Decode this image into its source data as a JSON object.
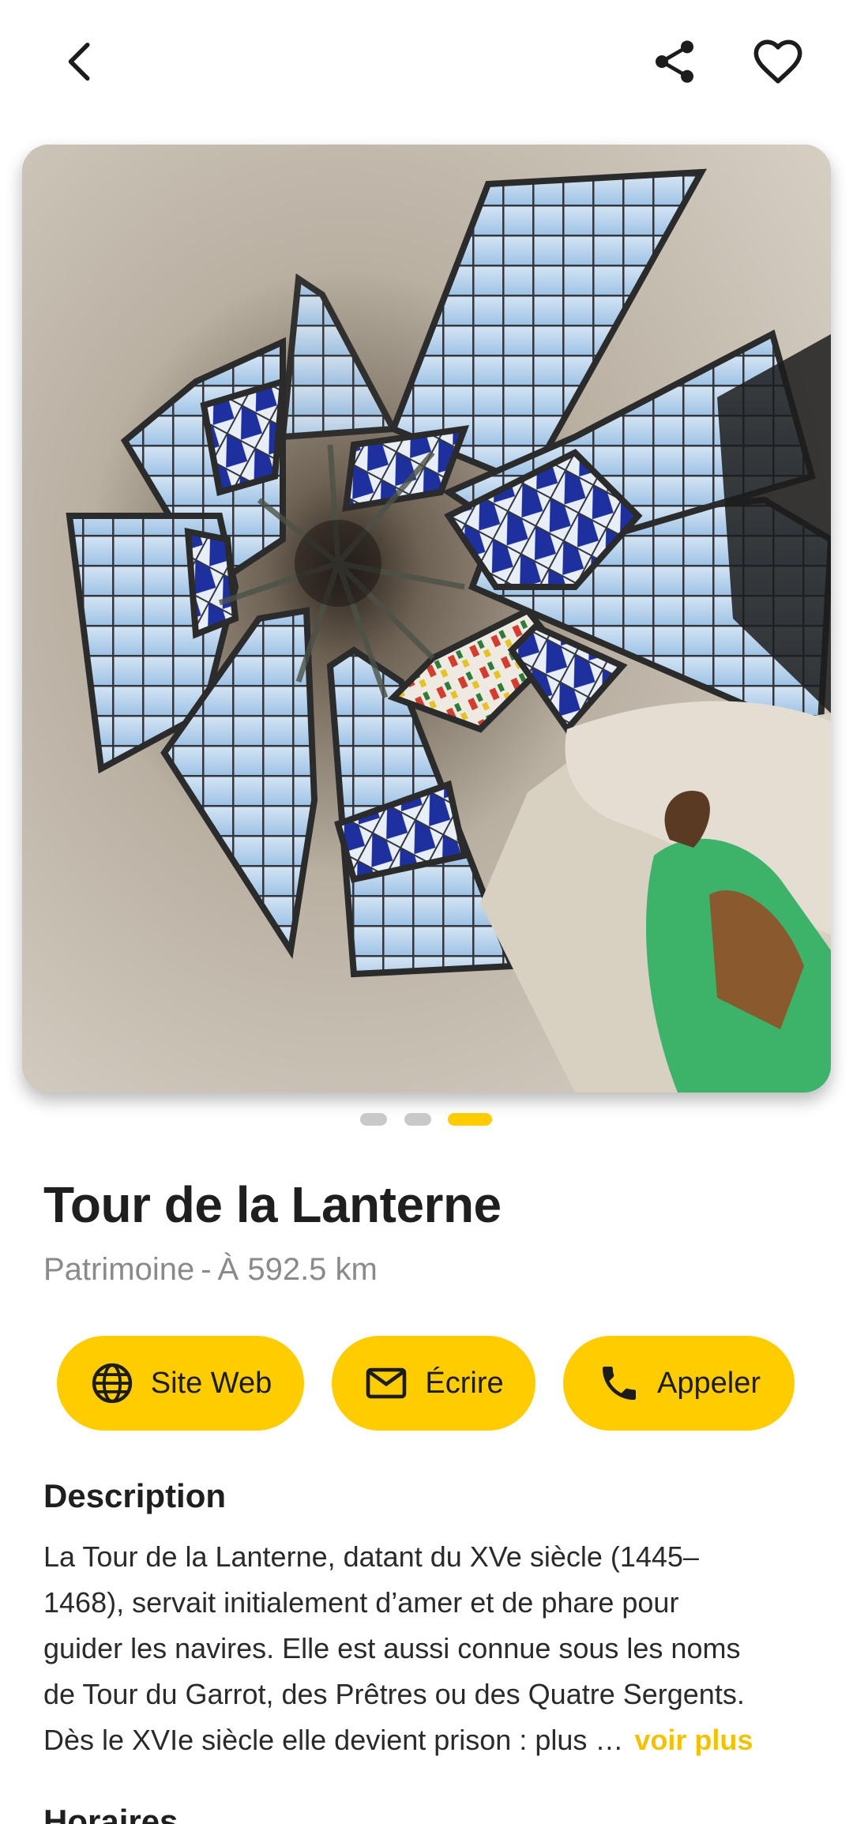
{
  "topbar": {
    "back_icon": "chevron-left-icon",
    "share_icon": "share-icon",
    "favorite_icon": "heart-outline-icon"
  },
  "carousel": {
    "image_count": 3,
    "active_index": 2,
    "active_color": "#ffcc00",
    "inactive_color": "#c9c9c9"
  },
  "place": {
    "title": "Tour de la Lanterne",
    "category": "Patrimoine",
    "separator": "-",
    "distance": "À 592.5 km"
  },
  "actions": [
    {
      "label": "Site Web",
      "icon": "globe-icon"
    },
    {
      "label": "Écrire",
      "icon": "mail-icon"
    },
    {
      "label": "Appeler",
      "icon": "phone-icon"
    }
  ],
  "accent_color": "#ffcc00",
  "description": {
    "heading": "Description",
    "lines": [
      "La Tour de la Lanterne, datant du XVe siècle (1445–",
      "1468), servait initialement d’amer et de phare pour",
      "guider les navires. Elle est aussi connue sous les noms",
      "de Tour du Garrot, des Prêtres ou des Quatre Sergents.",
      "Dès le XVIe siècle elle devient prison : plus …"
    ],
    "more_label": "voir plus"
  },
  "next_section": {
    "heading": "Horaires"
  }
}
